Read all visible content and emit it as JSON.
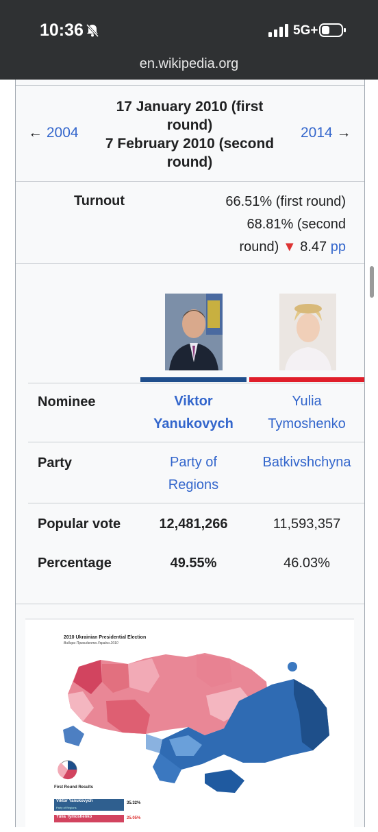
{
  "status_bar": {
    "time": "10:36",
    "network": "5G+"
  },
  "browser": {
    "url": "en.wikipedia.org"
  },
  "infobox": {
    "prev_election": "2004",
    "next_election": "2014",
    "date_lines": [
      "17 January 2010 (first",
      "round)",
      "7 February 2010 (second",
      "round)"
    ],
    "turnout_label": "Turnout",
    "turnout_lines": [
      "66.51% (first round)",
      "68.81% (second"
    ],
    "turnout_line3_prefix": "round)",
    "turnout_change": "8.47",
    "turnout_unit": "pp",
    "candidates": [
      {
        "nominee_line1": "Viktor",
        "nominee_line2": "Yanukovych",
        "party_line1": "Party of",
        "party_line2": "Regions",
        "popular_vote": "12,481,266",
        "percentage": "49.55%",
        "color": "#1f4e8c"
      },
      {
        "nominee_line1": "Yulia",
        "nominee_line2": "Tymoshenko",
        "party_line1": "Batkivshchyna",
        "party_line2": "",
        "popular_vote": "11,593,357",
        "percentage": "46.03%",
        "color": "#e01e2a"
      }
    ],
    "row_labels": {
      "nominee": "Nominee",
      "party": "Party",
      "popular_vote": "Popular vote",
      "percentage": "Percentage"
    }
  },
  "map": {
    "title": "2010 Ukrainian Presidential Election",
    "subtitle": "Вибори Президента України 2010",
    "results_title": "First Round Results",
    "result1_name": "Viktor Yanukovych",
    "result1_party": "Party of Regions",
    "result1_pct": "35.32%",
    "result2_name": "Yulia Tymoshenko",
    "result2_pct": "25.05%"
  }
}
